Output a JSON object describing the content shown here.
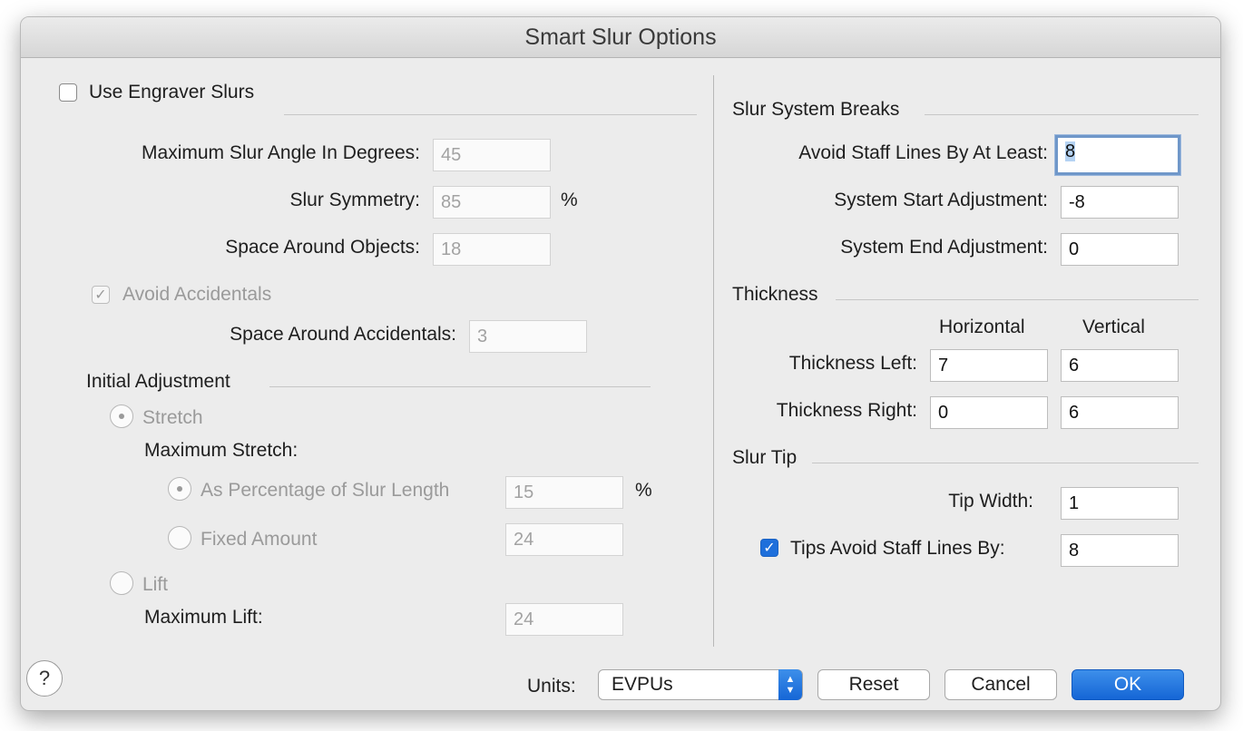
{
  "window": {
    "title": "Smart Slur Options"
  },
  "engraver": {
    "checkbox_label": "Use Engraver Slurs",
    "max_angle_label": "Maximum Slur Angle In Degrees:",
    "max_angle_value": "45",
    "symmetry_label": "Slur Symmetry:",
    "symmetry_value": "85",
    "symmetry_unit": "%",
    "space_objects_label": "Space Around Objects:",
    "space_objects_value": "18",
    "avoid_accidentals_label": "Avoid Accidentals",
    "space_accidentals_label": "Space Around Accidentals:",
    "space_accidentals_value": "3"
  },
  "initial_adjustment": {
    "heading": "Initial Adjustment",
    "stretch_label": "Stretch",
    "max_stretch_label": "Maximum Stretch:",
    "percentage_label": "As Percentage of Slur Length",
    "percentage_value": "15",
    "percentage_unit": "%",
    "fixed_label": "Fixed Amount",
    "fixed_value": "24",
    "lift_label": "Lift",
    "max_lift_label": "Maximum Lift:",
    "max_lift_value": "24"
  },
  "system_breaks": {
    "heading": "Slur System Breaks",
    "avoid_label": "Avoid Staff Lines By At Least:",
    "avoid_value": "8",
    "start_label": "System Start Adjustment:",
    "start_value": "-8",
    "end_label": "System End Adjustment:",
    "end_value": "0"
  },
  "thickness": {
    "heading": "Thickness",
    "col_horizontal": "Horizontal",
    "col_vertical": "Vertical",
    "left_label": "Thickness Left:",
    "left_h": "7",
    "left_v": "6",
    "right_label": "Thickness Right:",
    "right_h": "0",
    "right_v": "6"
  },
  "slur_tip": {
    "heading": "Slur Tip",
    "width_label": "Tip Width:",
    "width_value": "1",
    "avoid_label": "Tips Avoid Staff Lines By:",
    "avoid_value": "8"
  },
  "footer": {
    "units_label": "Units:",
    "units_value": "EVPUs",
    "reset": "Reset",
    "cancel": "Cancel",
    "ok": "OK",
    "help": "?"
  },
  "icons": {
    "help": "question-icon",
    "checkmark": "checkmark-icon",
    "select_arrows": "up-down-chevron-icon"
  },
  "colors": {
    "accent": "#1e6fdb",
    "focus_ring": "#6f97c9"
  }
}
